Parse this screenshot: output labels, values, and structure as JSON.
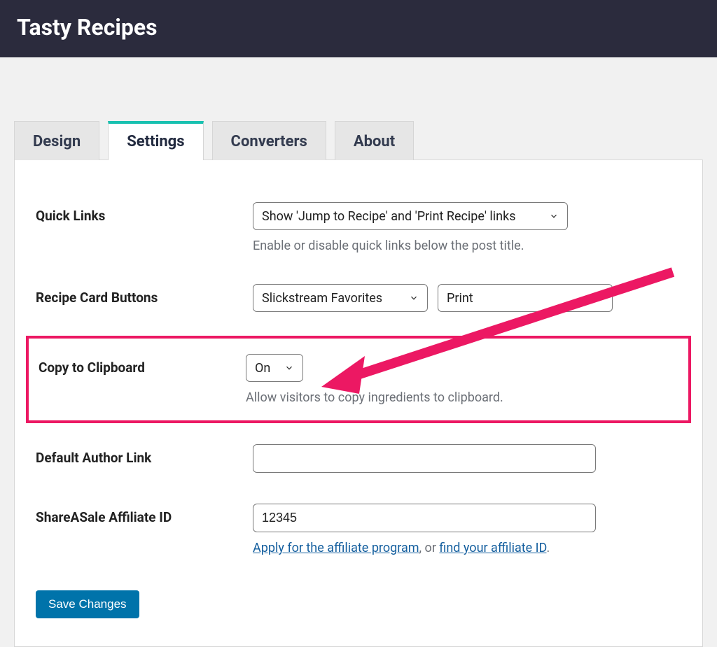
{
  "header": {
    "title": "Tasty Recipes"
  },
  "tabs": [
    {
      "label": "Design",
      "active": false
    },
    {
      "label": "Settings",
      "active": true
    },
    {
      "label": "Converters",
      "active": false
    },
    {
      "label": "About",
      "active": false
    }
  ],
  "form": {
    "quick_links": {
      "label": "Quick Links",
      "value": "Show 'Jump to Recipe' and 'Print Recipe' links",
      "help": "Enable or disable quick links below the post title."
    },
    "recipe_card_buttons": {
      "label": "Recipe Card Buttons",
      "button1": "Slickstream Favorites",
      "button2": "Print"
    },
    "copy_clipboard": {
      "label": "Copy to Clipboard",
      "value": "On",
      "help": "Allow visitors to copy ingredients to clipboard."
    },
    "default_author_link": {
      "label": "Default Author Link",
      "value": ""
    },
    "shareasale": {
      "label": "ShareASale Affiliate ID",
      "value": "12345",
      "help_prefix": "Apply for the affiliate program",
      "help_middle": ", or ",
      "help_suffix": "find your affiliate ID",
      "help_end": "."
    },
    "save_label": "Save Changes"
  },
  "colors": {
    "highlight": "#ec1863",
    "accent_tab": "#18c1b0",
    "header_bg": "#2b2b3d",
    "link": "#135e9e",
    "primary_btn": "#0073aa"
  }
}
